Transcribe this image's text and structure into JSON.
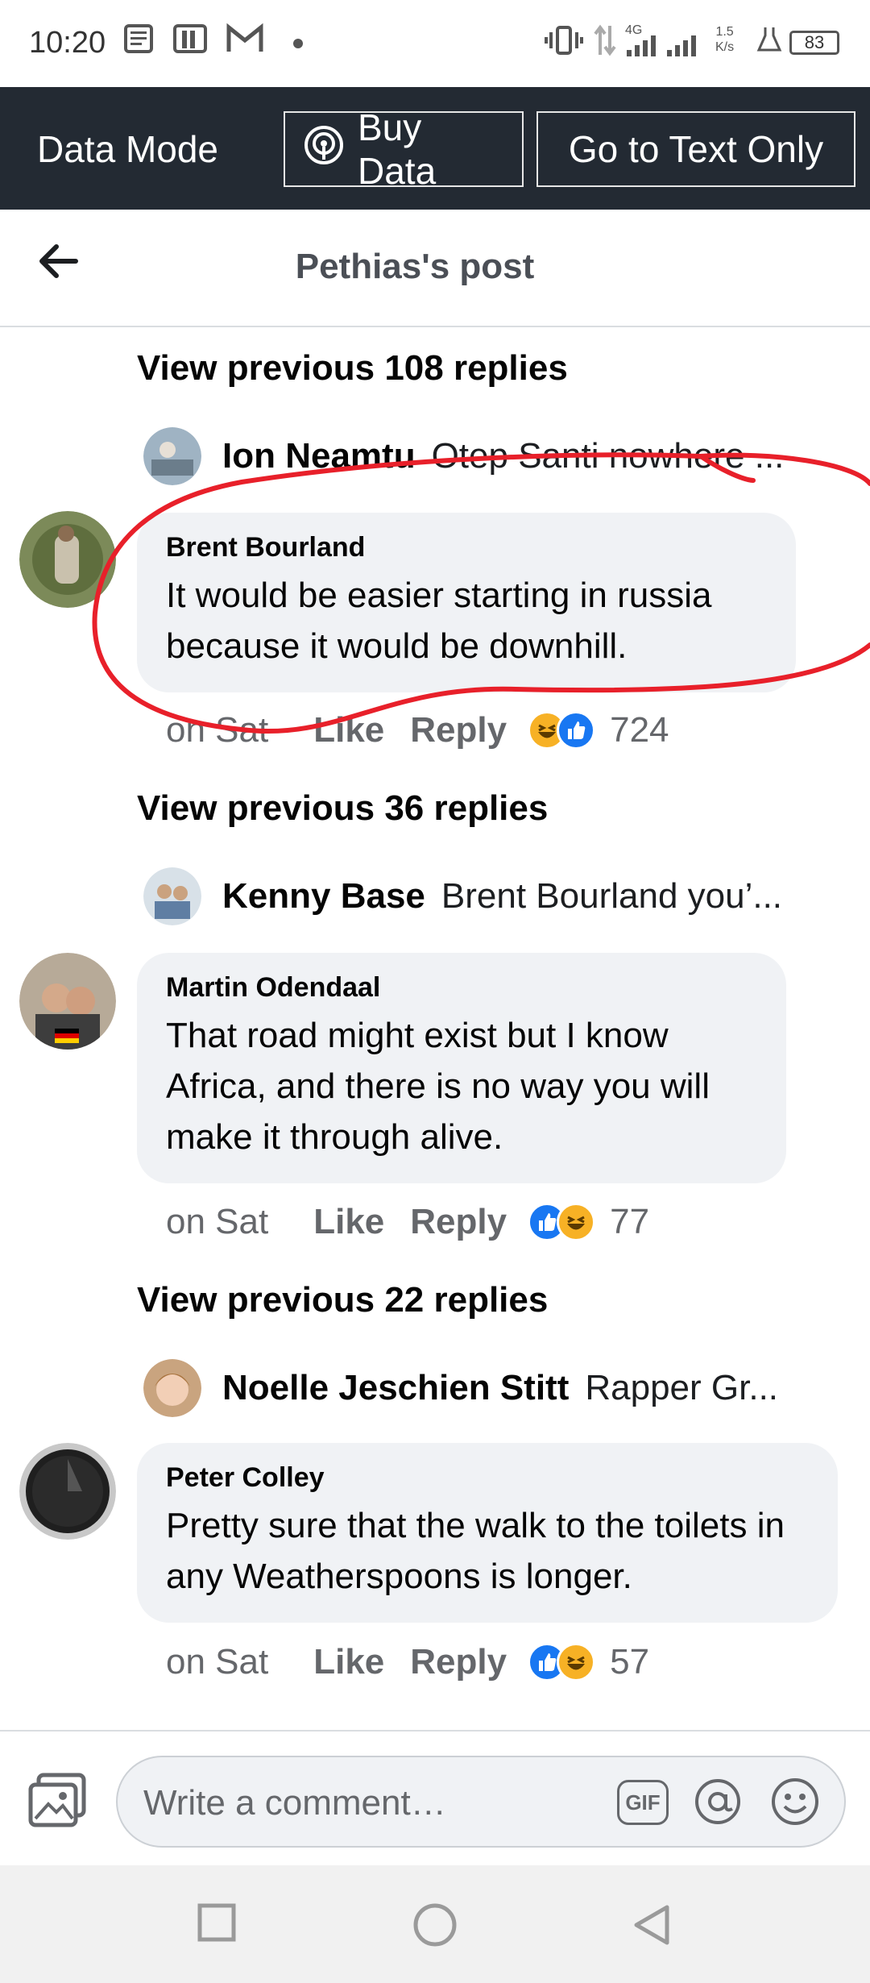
{
  "status_bar": {
    "time": "10:20",
    "network": "4G",
    "speed_value": "1.5",
    "speed_unit": "K/s",
    "battery": "83"
  },
  "data_bar": {
    "mode_label": "Data Mode",
    "buy_label": "Buy Data",
    "text_only_label": "Go to Text Only"
  },
  "header": {
    "title": "Pethias's post"
  },
  "threads": [
    {
      "view_previous": "View previous 108 replies",
      "preview": {
        "name": "Ion Neamtu",
        "text": "Otep Santi nowhere ..."
      },
      "comment": {
        "author": "Brent Bourland",
        "text": "It would be easier starting in russia because it would be downhill.",
        "time": "on Sat",
        "like": "Like",
        "reply": "Reply",
        "count": "724",
        "reactions": [
          "haha",
          "like"
        ]
      }
    },
    {
      "view_previous": "View previous 36 replies",
      "preview": {
        "name": "Kenny Base",
        "text": "Brent Bourland you’..."
      },
      "comment": {
        "author": "Martin Odendaal",
        "text": "That road might exist but I know Africa, and there is no way you will make it through alive.",
        "time": "on Sat",
        "like": "Like",
        "reply": "Reply",
        "count": "77",
        "reactions": [
          "like",
          "haha"
        ]
      }
    },
    {
      "view_previous": "View previous 22 replies",
      "preview": {
        "name": "Noelle Jeschien Stitt",
        "text": "Rapper Gr..."
      },
      "comment": {
        "author": "Peter Colley",
        "text": "Pretty sure that the walk to the toilets in any Weatherspoons is longer.",
        "time": "on Sat",
        "like": "Like",
        "reply": "Reply",
        "count": "57",
        "reactions": [
          "like",
          "haha"
        ]
      }
    }
  ],
  "composer": {
    "placeholder": "Write a comment…",
    "gif_label": "GIF"
  },
  "colors": {
    "data_bar_bg": "#232a33",
    "bubble_bg": "#f0f2f5",
    "like_blue": "#1877f2",
    "haha_yellow": "#f7b125",
    "annotation_red": "#e8202a"
  }
}
